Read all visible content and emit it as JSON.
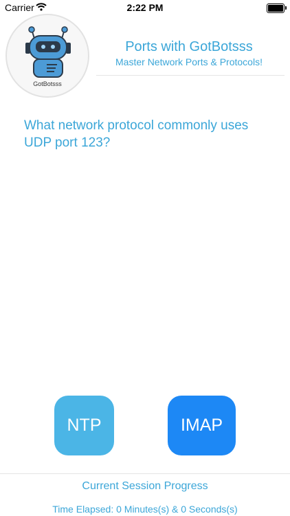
{
  "status_bar": {
    "carrier": "Carrier",
    "time": "2:22 PM"
  },
  "header": {
    "logo_text": "GotBotsss",
    "title": "Ports with GotBotsss",
    "subtitle": "Master Network Ports & Protocols!"
  },
  "quiz": {
    "question": "What network protocol commonly uses UDP port 123?",
    "answers": [
      {
        "label": "NTP"
      },
      {
        "label": "IMAP"
      }
    ]
  },
  "footer": {
    "progress_label": "Current Session Progress",
    "time_elapsed": "Time Elapsed: 0 Minutes(s) & 0 Seconds(s)"
  },
  "colors": {
    "accent": "#3ba6d8",
    "answer_light": "#4bb5e6",
    "answer_dark": "#1d88f5"
  }
}
